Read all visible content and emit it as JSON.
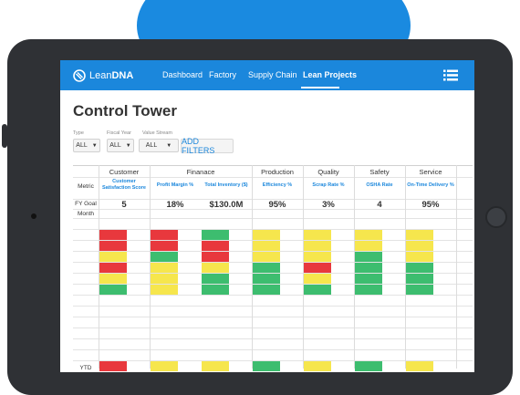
{
  "colors": {
    "accent": "#1b87dc",
    "red": "#e8383d",
    "yellow": "#f6e64d",
    "green": "#3dbd6f"
  },
  "brand": {
    "part1": "Lean",
    "part2": "DNA",
    "icon": "leandna-logo-icon"
  },
  "nav": {
    "links": [
      "Dashboard",
      "Factory",
      "Supply Chain",
      "Lean Projects"
    ],
    "active": "Lean Projects",
    "menu_icon": "list-menu-icon"
  },
  "page": {
    "title": "Control Tower"
  },
  "filters": {
    "type_label": "Type",
    "type_value": "ALL",
    "fiscal_label": "Fiscal Year",
    "fiscal_value": "ALL",
    "stream_label": "Value Stream",
    "stream_value": "ALL",
    "add_label": "ADD FILTERS"
  },
  "table": {
    "categories": [
      "Customer",
      "Finanace",
      "Production",
      "Quality",
      "Safety",
      "Service"
    ],
    "row_labels": {
      "metric": "Metric",
      "goal": "FY Goal",
      "month": "Month",
      "ytd": "YTD"
    },
    "metrics": [
      "Customer Satisfaction Score",
      "Profit Margin %",
      "Total Inventory ($)",
      "Efficiency %",
      "Scrap Rate %",
      "OSHA Rate",
      "On-Time Delivery %"
    ],
    "goals": [
      "5",
      "18%",
      "$130.0M",
      "95%",
      "3%",
      "4",
      "95%"
    ],
    "months": [
      [
        "red",
        "red",
        "green",
        "yellow",
        "yellow",
        "yellow",
        "yellow"
      ],
      [
        "red",
        "red",
        "red",
        "yellow",
        "yellow",
        "yellow",
        "yellow"
      ],
      [
        "yellow",
        "green",
        "red",
        "yellow",
        "yellow",
        "green",
        "yellow"
      ],
      [
        "red",
        "yellow",
        "yellow",
        "green",
        "red",
        "green",
        "green"
      ],
      [
        "yellow",
        "yellow",
        "green",
        "green",
        "yellow",
        "green",
        "green"
      ],
      [
        "green",
        "yellow",
        "green",
        "green",
        "green",
        "green",
        "green"
      ]
    ],
    "ytd": [
      "red",
      "yellow",
      "yellow",
      "green",
      "yellow",
      "green",
      "yellow"
    ]
  }
}
